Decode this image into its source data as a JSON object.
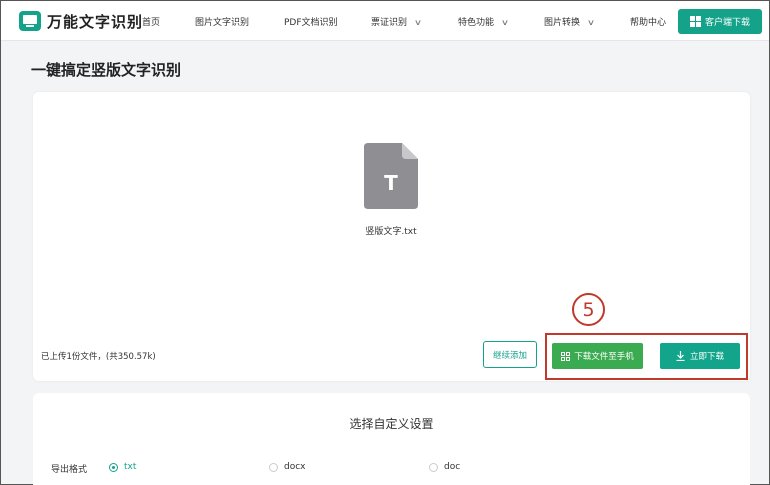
{
  "header": {
    "logo_text": "万能文字识别",
    "nav": {
      "home": "首页",
      "image_ocr": "图片文字识别",
      "pdf_ocr": "PDF文档识别",
      "ticket_ocr": "票证识别",
      "features": "特色功能",
      "image_convert": "图片转换",
      "help": "帮助中心"
    },
    "client_download": "客户端下载"
  },
  "page": {
    "title": "一键搞定竖版文字识别"
  },
  "upload": {
    "file_icon_letter": "T",
    "file_name": "竖版文字.txt",
    "info": "已上传1份文件，(共350.57k)",
    "continue_button": "继续添加",
    "download_phone_button": "下载文件至手机",
    "download_now_button": "立即下载",
    "step_marker": "5"
  },
  "settings": {
    "title": "选择自定义设置",
    "export_label": "导出格式",
    "formats": [
      "txt",
      "docx",
      "doc"
    ],
    "selected_format": "txt"
  },
  "colors": {
    "accent": "#14a38a",
    "green_button": "#3aab50",
    "highlight": "#c0392b"
  }
}
